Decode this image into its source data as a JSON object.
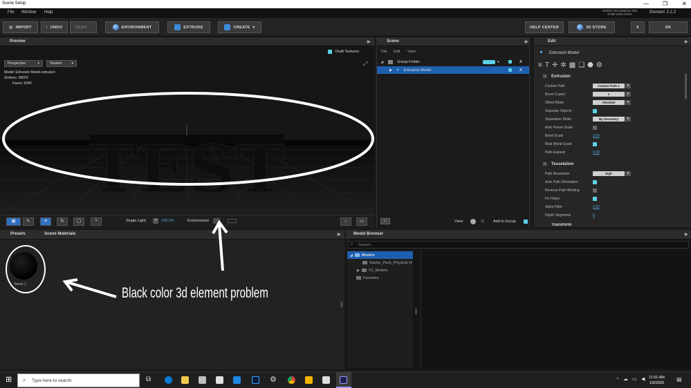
{
  "window": {
    "title": "Scene Setup",
    "minimize": "—",
    "restore": "❐",
    "close": "✕"
  },
  "menu": [
    "File",
    "Window",
    "Help"
  ],
  "header_info": {
    "gpu_line1": "Intel(R) HD Graphics 630",
    "gpu_line2": "0 MB Video RAM",
    "app_name": "Element",
    "version": "2.2.2"
  },
  "toolbar": {
    "import": "IMPORT",
    "undo": "UNDO",
    "redo": "REDO",
    "environment": "ENVIRONMENT",
    "extrude": "EXTRUDE",
    "create": "CREATE",
    "help_center": "HELP CENTER",
    "store": "3D STORE",
    "close": "X",
    "ok": "OK"
  },
  "preview": {
    "title": "Preview",
    "draft_textures": "Draft Textures",
    "camera": "Perspective",
    "shading": "Shaded",
    "info": {
      "model_label": "Model:",
      "model": "Extrusion Model.extrusion",
      "vertices_label": "Vertices:",
      "vertices": "28020",
      "faces_label": "Faces:",
      "faces": "9340"
    },
    "light": "Single Light",
    "light_value": "100.0%",
    "environment": "Environment"
  },
  "scene": {
    "title": "Scene",
    "menu": [
      "File",
      "Edit",
      "View"
    ],
    "items": [
      {
        "name": "Group Folder",
        "close": "X"
      },
      {
        "name": "Extrusion Model",
        "close": "X"
      }
    ],
    "view_label": "View:",
    "add_to_group": "Add to Group"
  },
  "edit": {
    "title": "Edit",
    "object": "Extrusion Model",
    "extrusion_section": "Extrusion",
    "extrusion_props": [
      {
        "label": "Custom Path",
        "value": "Custom Path 1"
      },
      {
        "label": "Bevel Copies",
        "value": "1"
      },
      {
        "label": "Offset Mode",
        "value": "Absolute"
      },
      {
        "label": "Separate Objects"
      },
      {
        "label": "Separation Mode",
        "value": "By Geometry"
      },
      {
        "label": "Auto Preset Scale"
      },
      {
        "label": "Bevel Scale",
        "value": "3.00"
      },
      {
        "label": "Real World Scale"
      },
      {
        "label": "Path Expand",
        "value": "0.00"
      }
    ],
    "tesselation_section": "Tesselation",
    "tesselation_props": [
      {
        "label": "Path Resolution",
        "value": "High"
      },
      {
        "label": "Auto Path Orientation"
      },
      {
        "label": "Reverse Path Winding"
      },
      {
        "label": "Fix Holes"
      },
      {
        "label": "Spike Filter",
        "value": "0.50"
      },
      {
        "label": "Depth Segments",
        "value": "0"
      }
    ],
    "transform_section": "Transform"
  },
  "presets": {
    "tabs": [
      "Presets",
      "Scene Materials"
    ],
    "material_name": "Bevel 1"
  },
  "model_browser": {
    "title": "Model Browser",
    "search_placeholder": "Search...",
    "tree": [
      "Models",
      "Starter_Pack_Physical (4",
      "V1_Models",
      "Favorites"
    ]
  },
  "annotation": {
    "text": "Black color 3d element problem"
  },
  "viewport_text": "TEST",
  "taskbar": {
    "search_placeholder": "Type here to search",
    "time": "11:51 AM",
    "date": "1/9/2020"
  },
  "colors": {
    "accent": "#3d8ad8",
    "selection": "#1f5fb0",
    "checkbox_on": "#5bd0e6"
  }
}
